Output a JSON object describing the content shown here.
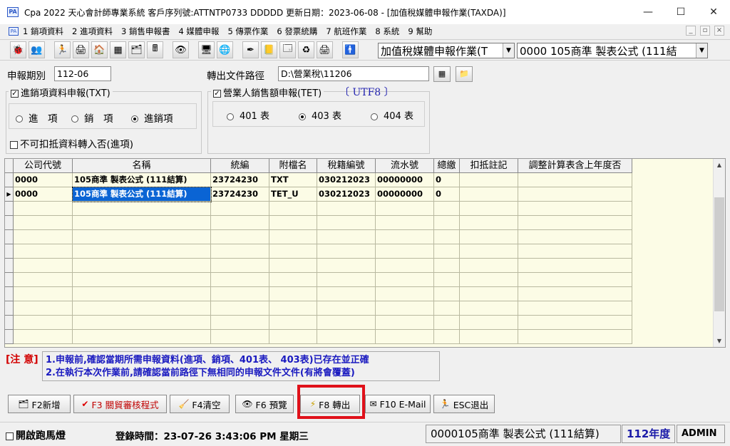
{
  "window": {
    "app_icon": "PA",
    "title": "Cpa 2022  天心會計師專業系統  客戶序列號:ATTNTP0733 DDDDD   更新日期：2023-06-08 - [加值稅媒體申報作業(TAXDA)]",
    "minimize": "—",
    "maximize": "☐",
    "close": "✕"
  },
  "menu": {
    "items": [
      "1 銷項資料",
      "2 進項資料",
      "3 銷售申報書",
      "4 媒體申報",
      "5 傳票作業",
      "6 發票統購",
      "7 航班作業",
      "8 系統",
      "9 幫助"
    ],
    "mdi": [
      "_",
      "▫",
      "×"
    ]
  },
  "toolbar": {
    "icons": [
      {
        "name": "user-red-icon",
        "glyph": "🐞"
      },
      {
        "name": "users-icon",
        "glyph": "👥"
      },
      {
        "name": "run-icon",
        "glyph": "🏃"
      },
      {
        "name": "printer-icon",
        "glyph": "🖨"
      },
      {
        "name": "home-icon",
        "glyph": "🏠"
      },
      {
        "name": "table-icon",
        "glyph": "▦"
      },
      {
        "name": "layers-icon",
        "glyph": "🗂"
      },
      {
        "name": "calculator-icon",
        "glyph": "🖩"
      },
      {
        "name": "eye-icon",
        "glyph": "👁"
      },
      {
        "name": "monitor-icon",
        "glyph": "🖥"
      },
      {
        "name": "globe-icon",
        "glyph": "🌐"
      },
      {
        "name": "pen-icon",
        "glyph": "✒"
      },
      {
        "name": "note-icon",
        "glyph": "📒"
      },
      {
        "name": "window-icon",
        "glyph": "🗔"
      },
      {
        "name": "refresh-icon",
        "glyph": "♻"
      },
      {
        "name": "print-alt-icon",
        "glyph": "🖨"
      },
      {
        "name": "person-icon",
        "glyph": "🚹"
      }
    ],
    "task_combo": "加值稅媒體申報作業(T",
    "company_combo": "0000  105商準 製表公式 (111結"
  },
  "form": {
    "period_label": "申報期別",
    "period_value": "112-06",
    "export_path_label": "轉出文件路徑",
    "export_path_value": "D:\\營業稅\\11206",
    "txt_group_title": "進銷項資料申報(TXT)",
    "txt_checked": "✓",
    "radio_in": "進　項",
    "radio_out": "銷　項",
    "radio_both": "進銷項",
    "non_deductible": "不可扣抵資料轉入否(進項)",
    "tet_group_title": "營業人銷售額申報(TET)",
    "tet_checked": "✓",
    "utf8_label": "〔 UTF8 〕",
    "radio_401": "401 表",
    "radio_403": "403 表",
    "radio_404": "404 表"
  },
  "grid": {
    "columns": [
      "公司代號",
      "名稱",
      "統編",
      "附檔名",
      "稅籍編號",
      "流水號",
      "總繳",
      "扣抵註記",
      "調整計算表含上年度否"
    ],
    "rows": [
      [
        "0000",
        "105商準 製表公式 (111結算)",
        "23724230",
        "TXT",
        "030212023",
        "00000000",
        "0",
        "",
        ""
      ],
      [
        "0000",
        "105商準 製表公式 (111結算)",
        "23724230",
        "TET_U",
        "030212023",
        "00000000",
        "0",
        "",
        ""
      ]
    ],
    "current_row_marker": "▶"
  },
  "note": {
    "label": "[注 意]",
    "line1": "1.申報前,確認當期所需申報資料(進項、銷項、401表、 403表)已存在並正確",
    "line2": "2.在執行本次作業前,請確認當前路徑下無相同的申報文件文件(有將會覆蓋)"
  },
  "buttons": {
    "f2": "F2新增",
    "f3": "F3 關貿審核程式",
    "f4": "F4清空",
    "f6": "F6 預覽",
    "f8": "F8 轉出",
    "f10": "F10 E-Mail",
    "esc": "ESC退出"
  },
  "status": {
    "marquee": "開啟跑馬燈",
    "login_time": "登錄時間：23-07-26 3:43:06 PM  星期三",
    "company": "0000105商準 製表公式 (111結算)",
    "year": "112年度",
    "user": "ADMIN"
  }
}
